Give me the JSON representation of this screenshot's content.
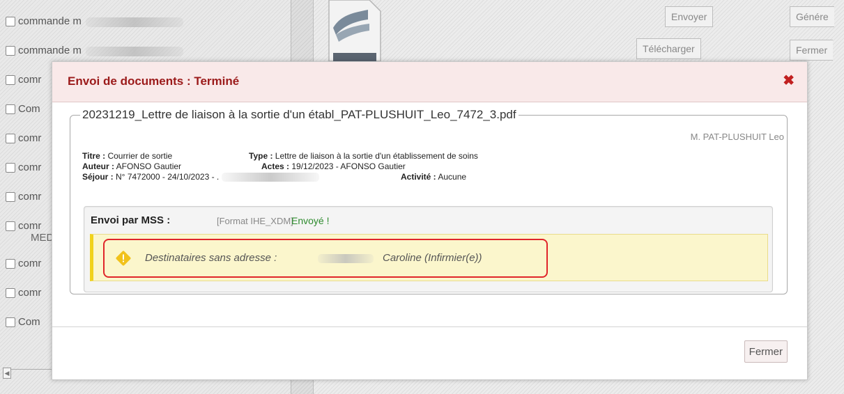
{
  "background": {
    "left_items": [
      {
        "label": "commande m"
      },
      {
        "label": "commande m"
      },
      {
        "label": "comr"
      },
      {
        "label": "Com"
      },
      {
        "label": "comr"
      },
      {
        "label": "comr"
      },
      {
        "label": "comr"
      },
      {
        "label": "comr",
        "sub": "MED"
      },
      {
        "label": "comr"
      },
      {
        "label": "comr"
      },
      {
        "label": "Com"
      }
    ],
    "buttons": {
      "envoyer": "Envoyer",
      "generer": "Génére",
      "telecharger": "Télécharger",
      "fermer": "Fermer"
    },
    "file_label": "PDF"
  },
  "dialog": {
    "title": "Envoi de documents : Terminé",
    "close_icon": "close-x-icon",
    "header_color": "#f9e9e9",
    "title_color": "#9b1a1a",
    "document": {
      "filename": "20231219_Lettre de liaison à la sortie d'un établ_PAT-PLUSHUIT_Leo_7472_3.pdf",
      "patient": "M. PAT-PLUSHUIT Leo",
      "titre_label": "Titre :",
      "titre_value": "Courrier de sortie",
      "type_label": "Type :",
      "type_value": "Lettre de liaison à la sortie d'un établissement de soins",
      "auteur_label": "Auteur :",
      "auteur_value": "AFONSO Gautier",
      "actes_label": "Actes :",
      "actes_value": "19/12/2023 - AFONSO Gautier",
      "sejour_label": "Séjour :",
      "sejour_value": "N° 7472000 - 24/10/2023 - .",
      "activite_label": "Activité :",
      "activite_value": "Aucune"
    },
    "mss": {
      "title": "Envoi par MSS :",
      "format": "[Format IHE_XDM]",
      "status": "Envoyé !",
      "status_color": "#2e8b2e",
      "warning_label": "Destinataires sans adresse :",
      "warning_recipient": "Caroline (Infirmier(e))",
      "warning_icon": "warning-diamond-icon",
      "warning_color": "#f1d21b",
      "highlight_color": "#e0252a"
    },
    "footer": {
      "close_button": "Fermer"
    }
  }
}
